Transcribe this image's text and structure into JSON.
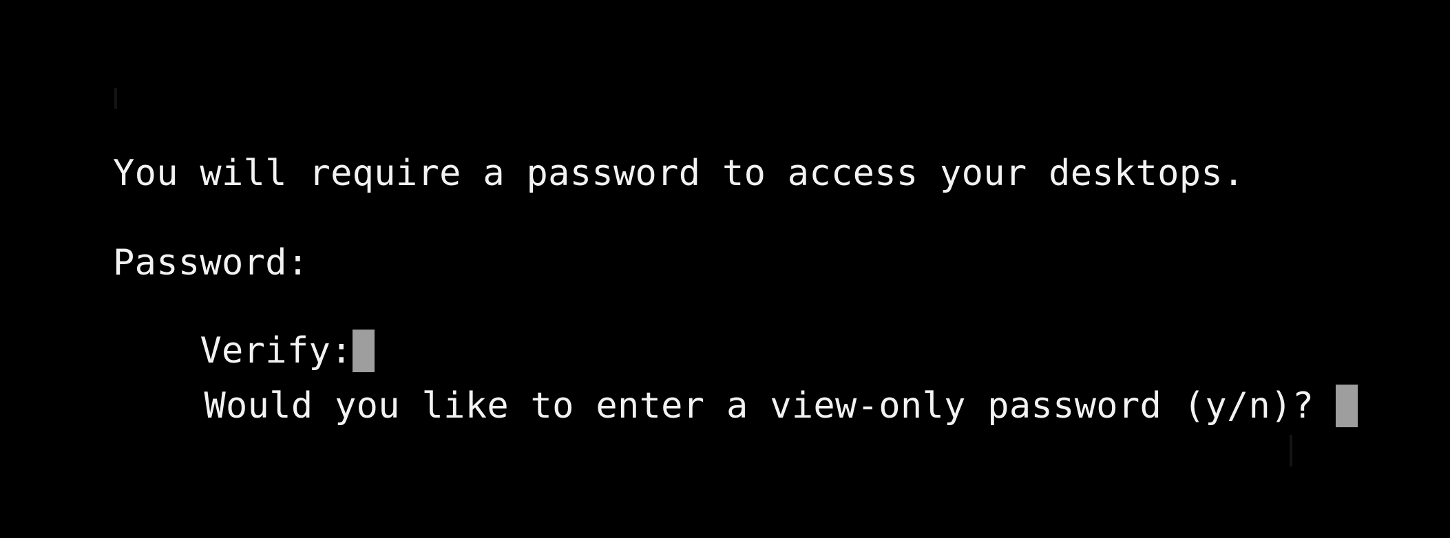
{
  "terminal": {
    "lines": {
      "info": "You will require a password to access your desktops.",
      "password_prompt": "Password:",
      "verify_prompt": "Verify:",
      "view_only_prompt": "Would you like to enter a view-only password (y/n)? "
    },
    "cursor_color": "#9e9e9e",
    "background_color": "#000000",
    "text_color": "#f2f2f2"
  }
}
